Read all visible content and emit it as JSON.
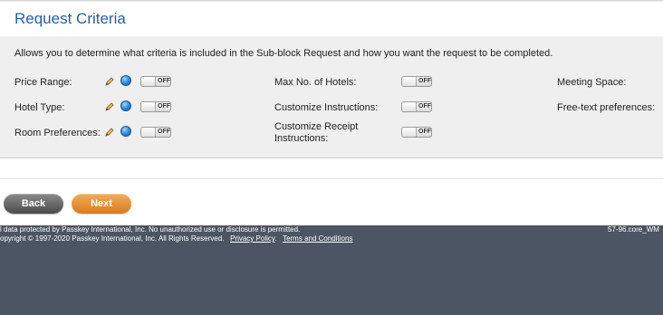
{
  "panel": {
    "title": "Request Criteria",
    "description": "Allows you to determine what criteria is included in the Sub-block Request and how you want the request to be completed."
  },
  "criteria": {
    "price_range": {
      "label": "Price Range:",
      "toggle": "OFF"
    },
    "hotel_type": {
      "label": "Hotel Type:",
      "toggle": "OFF"
    },
    "room_preferences": {
      "label": "Room Preferences:",
      "toggle": "OFF"
    },
    "max_hotels": {
      "label": "Max No. of Hotels:",
      "toggle": "OFF"
    },
    "customize_instructions": {
      "label": "Customize Instructions:",
      "toggle": "OFF"
    },
    "customize_receipt_line1": "Customize Receipt",
    "customize_receipt_line2": "Instructions:",
    "customize_receipt_toggle": "OFF",
    "meeting_space": {
      "label": "Meeting Space:"
    },
    "free_text": {
      "label": "Free-text preferences:"
    }
  },
  "icons": {
    "pencil": "pencil-icon",
    "globe": "globe-icon"
  },
  "buttons": {
    "back": "Back",
    "next": "Next"
  },
  "footer": {
    "line1": "l data protected by Passkey International, Inc. No unauthorized use or disclosure is permitted.",
    "line2": "opyright © 1997-2020 Passkey International, Inc. All Rights Reserved.",
    "privacy": "Privacy Policy",
    "separator": ".",
    "terms": "Terms and Conditions",
    "version": "57-96.core_WM"
  },
  "colors": {
    "title": "#2b5e9e",
    "footer_bg": "#4b5563",
    "next_button": "#e08a2e",
    "back_button": "#5a5a5a"
  }
}
